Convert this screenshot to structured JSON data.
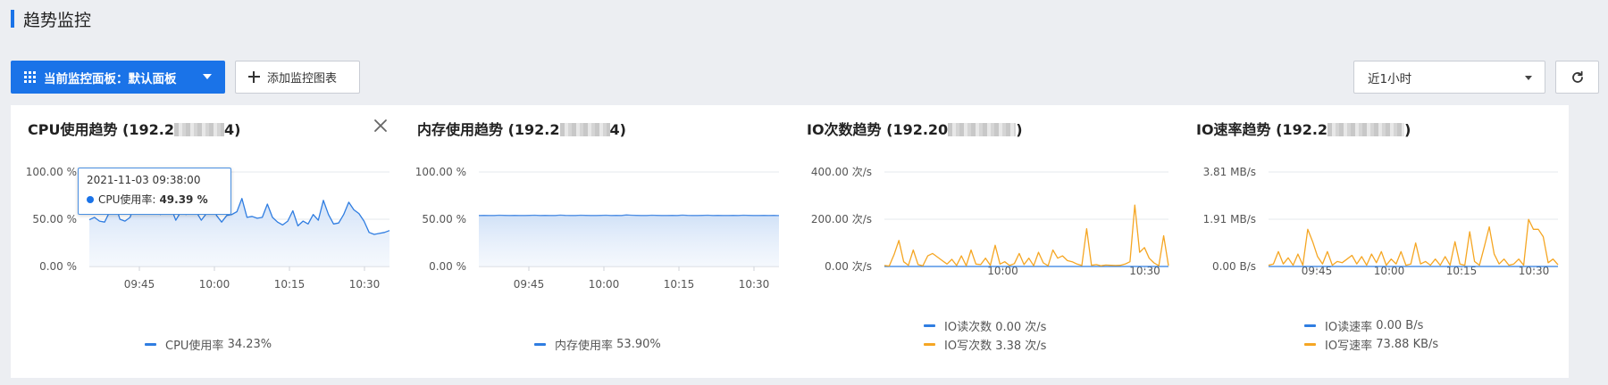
{
  "page": {
    "title": "趋势监控"
  },
  "toolbar": {
    "dashboard_button_label": "当前监控面板：默认面板",
    "add_chart_label": "添加监控图表",
    "time_range": "近1小时",
    "refresh_icon": "refresh-icon"
  },
  "colors": {
    "primary": "#1a73e8",
    "cpu_line": "#2f7de1",
    "mem_line": "#4f8fe4",
    "io_write": "#f5a623",
    "io_read": "#2f7de1"
  },
  "panels": [
    {
      "id": "cpu",
      "title_prefix": "CPU使用趋势 (192.2",
      "title_suffix": "4)",
      "legend": [
        {
          "name": "CPU使用率",
          "value": "34.23%"
        }
      ],
      "closable": true
    },
    {
      "id": "mem",
      "title_prefix": "内存使用趋势 (192.2",
      "title_suffix": "4)",
      "legend": [
        {
          "name": "内存使用率",
          "value": "53.90%"
        }
      ]
    },
    {
      "id": "io_count",
      "title_prefix": "IO次数趋势 (192.20",
      "title_suffix": ")",
      "legend": [
        {
          "name": "IO读次数",
          "value": "0.00 次/s"
        },
        {
          "name": "IO写次数",
          "value": "3.38 次/s"
        }
      ]
    },
    {
      "id": "io_rate",
      "title_prefix": "IO速率趋势 (192.2",
      "title_suffix": ")",
      "legend": [
        {
          "name": "IO读速率",
          "value": "0.00 B/s"
        },
        {
          "name": "IO写速率",
          "value": "73.88 KB/s"
        }
      ]
    }
  ],
  "tooltip": {
    "time": "2021-11-03 09:38:00",
    "label": "CPU使用率:",
    "value": "49.39 %"
  },
  "chart_data": [
    {
      "type": "area",
      "title": "CPU使用趋势",
      "yticks": [
        "100.00 %",
        "50.00 %",
        "0.00 %"
      ],
      "ylim": [
        0,
        100
      ],
      "xticks": [
        "09:45",
        "10:00",
        "10:15",
        "10:30"
      ],
      "x_range": [
        "09:35",
        "10:35"
      ],
      "series": [
        {
          "name": "CPU使用率",
          "values": [
            49.4,
            52,
            48,
            47,
            58,
            68,
            50,
            48,
            52,
            68,
            58,
            57,
            66,
            58,
            55,
            68,
            63,
            49,
            58,
            55,
            65,
            58,
            49,
            56,
            68,
            54,
            47,
            54,
            55,
            58,
            72,
            52,
            53,
            51,
            52,
            66,
            52,
            47,
            44,
            48,
            59,
            43,
            48,
            45,
            55,
            49,
            70,
            55,
            45,
            46,
            55,
            68,
            60,
            56,
            48,
            36,
            34,
            35,
            36,
            38
          ]
        }
      ]
    },
    {
      "type": "area",
      "title": "内存使用趋势",
      "yticks": [
        "100.00 %",
        "50.00 %",
        "0.00 %"
      ],
      "ylim": [
        0,
        100
      ],
      "xticks": [
        "09:45",
        "10:00",
        "10:15",
        "10:30"
      ],
      "x_range": [
        "09:35",
        "10:35"
      ],
      "series": [
        {
          "name": "内存使用率",
          "values": [
            54.0,
            54.1,
            54.0,
            54.0,
            54.2,
            54.1,
            54.0,
            54.1,
            54.0,
            54.0,
            54.1,
            54.2,
            54.0,
            54.1,
            54.0,
            54.0,
            54.3,
            54.1,
            54.0,
            54.0,
            54.2,
            54.1,
            54.0,
            54.0,
            54.1,
            54.2,
            54.0,
            54.1,
            54.0,
            54.5,
            54.2,
            54.1,
            54.0,
            54.0,
            54.2,
            54.1,
            54.0,
            54.0,
            54.1,
            54.0,
            54.3,
            54.1,
            54.0,
            54.0,
            54.1,
            54.2,
            54.0,
            54.1,
            54.0,
            54.0,
            54.1,
            54.0,
            54.2,
            54.1,
            54.0,
            54.0,
            54.1,
            54.0,
            54.1,
            53.9
          ]
        }
      ]
    },
    {
      "type": "line",
      "title": "IO次数趋势",
      "yticks": [
        "400.00 次/s",
        "200.00 次/s",
        "0.00 次/s"
      ],
      "ylim": [
        0,
        400
      ],
      "xticks": [
        "10:00",
        "10:30"
      ],
      "x_range": [
        "09:35",
        "10:35"
      ],
      "series": [
        {
          "name": "IO读次数",
          "values": [
            0,
            0,
            0,
            0,
            0,
            0,
            0,
            0,
            0,
            0,
            0,
            0,
            0,
            0,
            0,
            0,
            0,
            0,
            0,
            0,
            0,
            0,
            0,
            0,
            0,
            0,
            0,
            0,
            0,
            0,
            0,
            0,
            0,
            0,
            0,
            0,
            0,
            0,
            0,
            0,
            0,
            0,
            0,
            0,
            0,
            0,
            0,
            0,
            0,
            0,
            0,
            0,
            0,
            0,
            0,
            0,
            0,
            0,
            0,
            0
          ]
        },
        {
          "name": "IO写次数",
          "values": [
            4,
            2,
            50,
            110,
            20,
            5,
            70,
            8,
            3,
            45,
            55,
            40,
            25,
            10,
            30,
            4,
            45,
            3,
            70,
            10,
            8,
            35,
            5,
            90,
            10,
            20,
            4,
            12,
            55,
            8,
            35,
            3,
            60,
            15,
            3,
            70,
            35,
            45,
            25,
            20,
            10,
            4,
            160,
            5,
            8,
            3,
            6,
            5,
            4,
            5,
            10,
            20,
            260,
            60,
            80,
            35,
            15,
            3,
            130,
            3.38
          ]
        }
      ]
    },
    {
      "type": "line",
      "title": "IO速率趋势",
      "yticks": [
        "3.81 MB/s",
        "1.91 MB/s",
        "0.00 B/s"
      ],
      "ylim": [
        0,
        3.81
      ],
      "unit": "MB/s",
      "xticks": [
        "09:45",
        "10:00",
        "10:15",
        "10:30"
      ],
      "x_range": [
        "09:35",
        "10:35"
      ],
      "series": [
        {
          "name": "IO读速率",
          "values": [
            0,
            0,
            0,
            0,
            0,
            0,
            0,
            0,
            0,
            0,
            0,
            0,
            0,
            0,
            0,
            0,
            0,
            0,
            0,
            0,
            0,
            0,
            0,
            0,
            0,
            0,
            0,
            0,
            0,
            0,
            0,
            0,
            0,
            0,
            0,
            0,
            0,
            0,
            0,
            0,
            0,
            0,
            0,
            0,
            0,
            0,
            0,
            0,
            0,
            0,
            0,
            0,
            0,
            0,
            0,
            0,
            0,
            0,
            0,
            0
          ]
        },
        {
          "name": "IO写速率",
          "values": [
            0.05,
            0.1,
            0.6,
            0.1,
            0.35,
            0.05,
            0.5,
            0.05,
            1.5,
            1.0,
            0.4,
            0.1,
            0.6,
            0.05,
            0.2,
            0.15,
            0.3,
            0.45,
            0.1,
            0.4,
            0.05,
            0.5,
            0.15,
            0.6,
            0.05,
            0.3,
            0.1,
            0.6,
            0.05,
            0.1,
            0.95,
            0.1,
            0.2,
            0.05,
            0.3,
            0.05,
            0.4,
            0.05,
            1.0,
            0.1,
            0.05,
            1.4,
            0.2,
            0.05,
            0.8,
            1.6,
            0.5,
            0.1,
            0.3,
            0.05,
            0.1,
            0.3,
            0.05,
            1.9,
            1.5,
            1.5,
            1.2,
            0.15,
            0.3,
            0.07
          ]
        }
      ]
    }
  ]
}
